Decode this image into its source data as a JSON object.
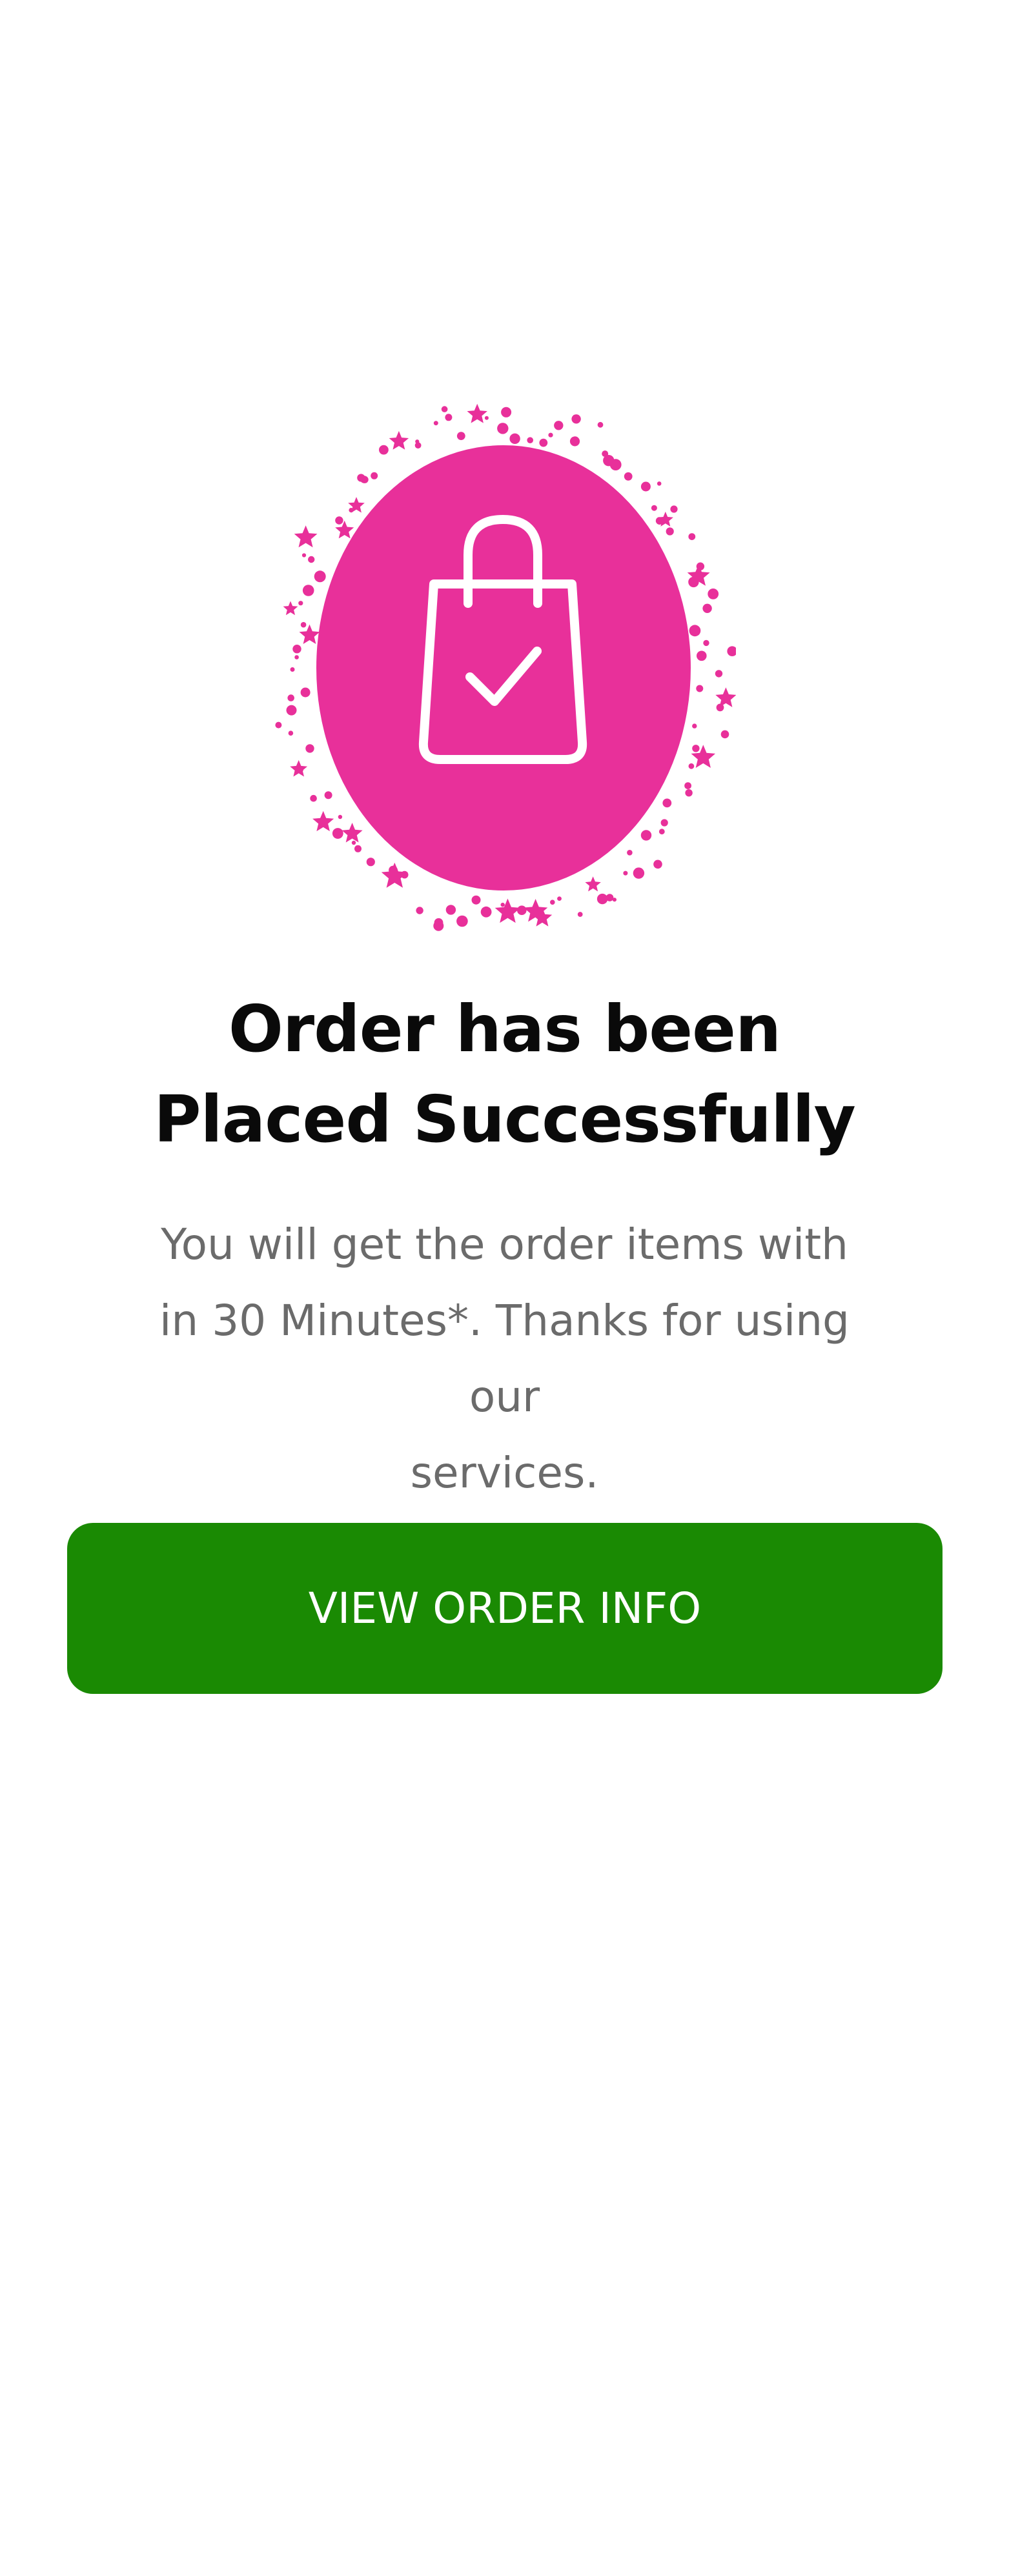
{
  "colors": {
    "accent": "#e8309a",
    "button": "#1a8a03",
    "title": "#0a0a0a",
    "body_text": "#6b6b6b",
    "background": "#ffffff"
  },
  "illustration": {
    "icon": "shopping-bag-check-icon",
    "decoration": "confetti-stars-and-dots"
  },
  "confirmation": {
    "title_line1": "Order has been",
    "title_line2": "Placed Successfully",
    "message_line1": "You will get the order items with",
    "message_line2": "in 30 Minutes*. Thanks for using our",
    "message_line3": "services."
  },
  "actions": {
    "view_order_label": "VIEW ORDER INFO"
  }
}
